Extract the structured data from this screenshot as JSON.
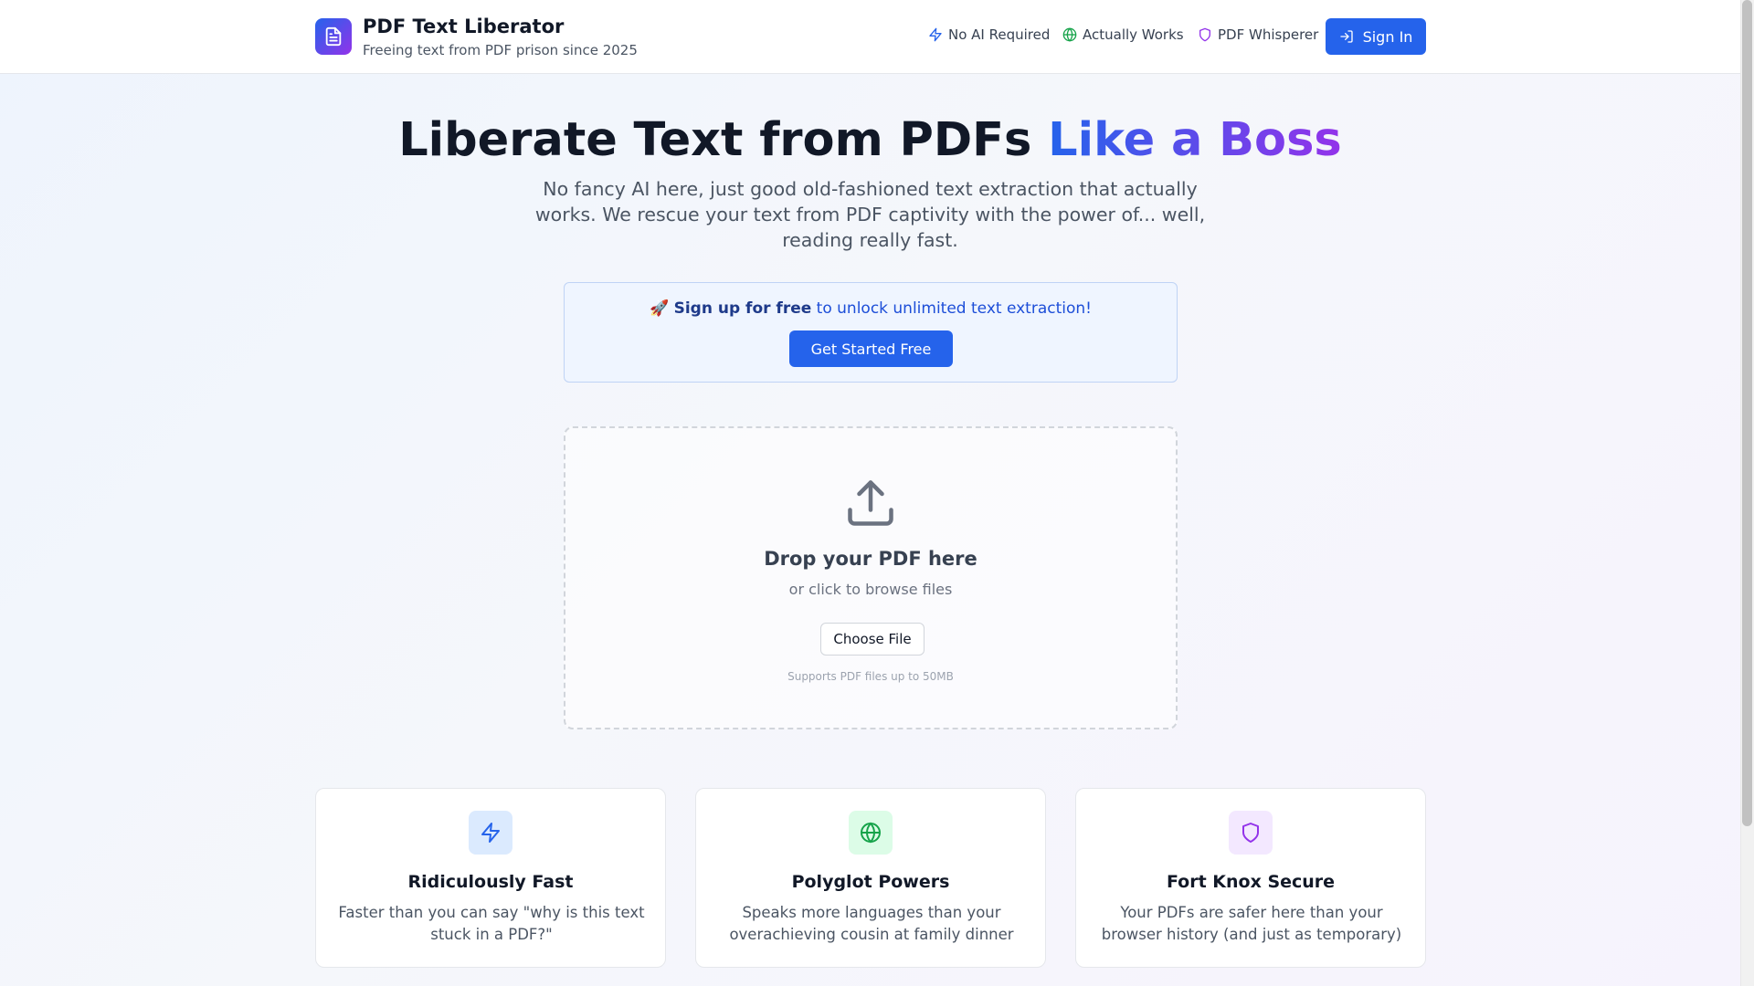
{
  "header": {
    "brand_title": "PDF Text Liberator",
    "brand_subtitle": "Freeing text from PDF prison since 2025",
    "nav": [
      {
        "label": "No AI Required",
        "icon": "lightning-icon",
        "color": "#2563eb"
      },
      {
        "label": "Actually Works",
        "icon": "globe-icon",
        "color": "#16a34a"
      },
      {
        "label": "PDF Whisperer",
        "icon": "shield-icon",
        "color": "#9333ea"
      }
    ],
    "signin_label": "Sign In"
  },
  "hero": {
    "title_main": "Liberate Text from PDFs ",
    "title_accent": "Like a Boss",
    "description": "No fancy AI here, just good old-fashioned text extraction that actually works. We rescue your text from PDF captivity with the power of... well, reading really fast."
  },
  "cta": {
    "emoji": "🚀",
    "bold_text": "Sign up for free",
    "rest_text": " to unlock unlimited text extraction!",
    "button_label": "Get Started Free"
  },
  "dropzone": {
    "title": "Drop your PDF here",
    "subtitle": "or click to browse files",
    "button_label": "Choose File",
    "note": "Supports PDF files up to 50MB"
  },
  "features": [
    {
      "title": "Ridiculously Fast",
      "description": "Faster than you can say \"why is this text stuck in a PDF?\"",
      "icon": "lightning-icon",
      "color": "#2563eb",
      "bg": "#dbeafe"
    },
    {
      "title": "Polyglot Powers",
      "description": "Speaks more languages than your overachieving cousin at family dinner",
      "icon": "globe-icon",
      "color": "#16a34a",
      "bg": "#dcfce7"
    },
    {
      "title": "Fort Knox Secure",
      "description": "Your PDFs are safer here than your browser history (and just as temporary)",
      "icon": "shield-icon",
      "color": "#9333ea",
      "bg": "#f3e8ff"
    }
  ],
  "colors": {
    "primary": "#2563eb",
    "accent": "#9333ea"
  }
}
